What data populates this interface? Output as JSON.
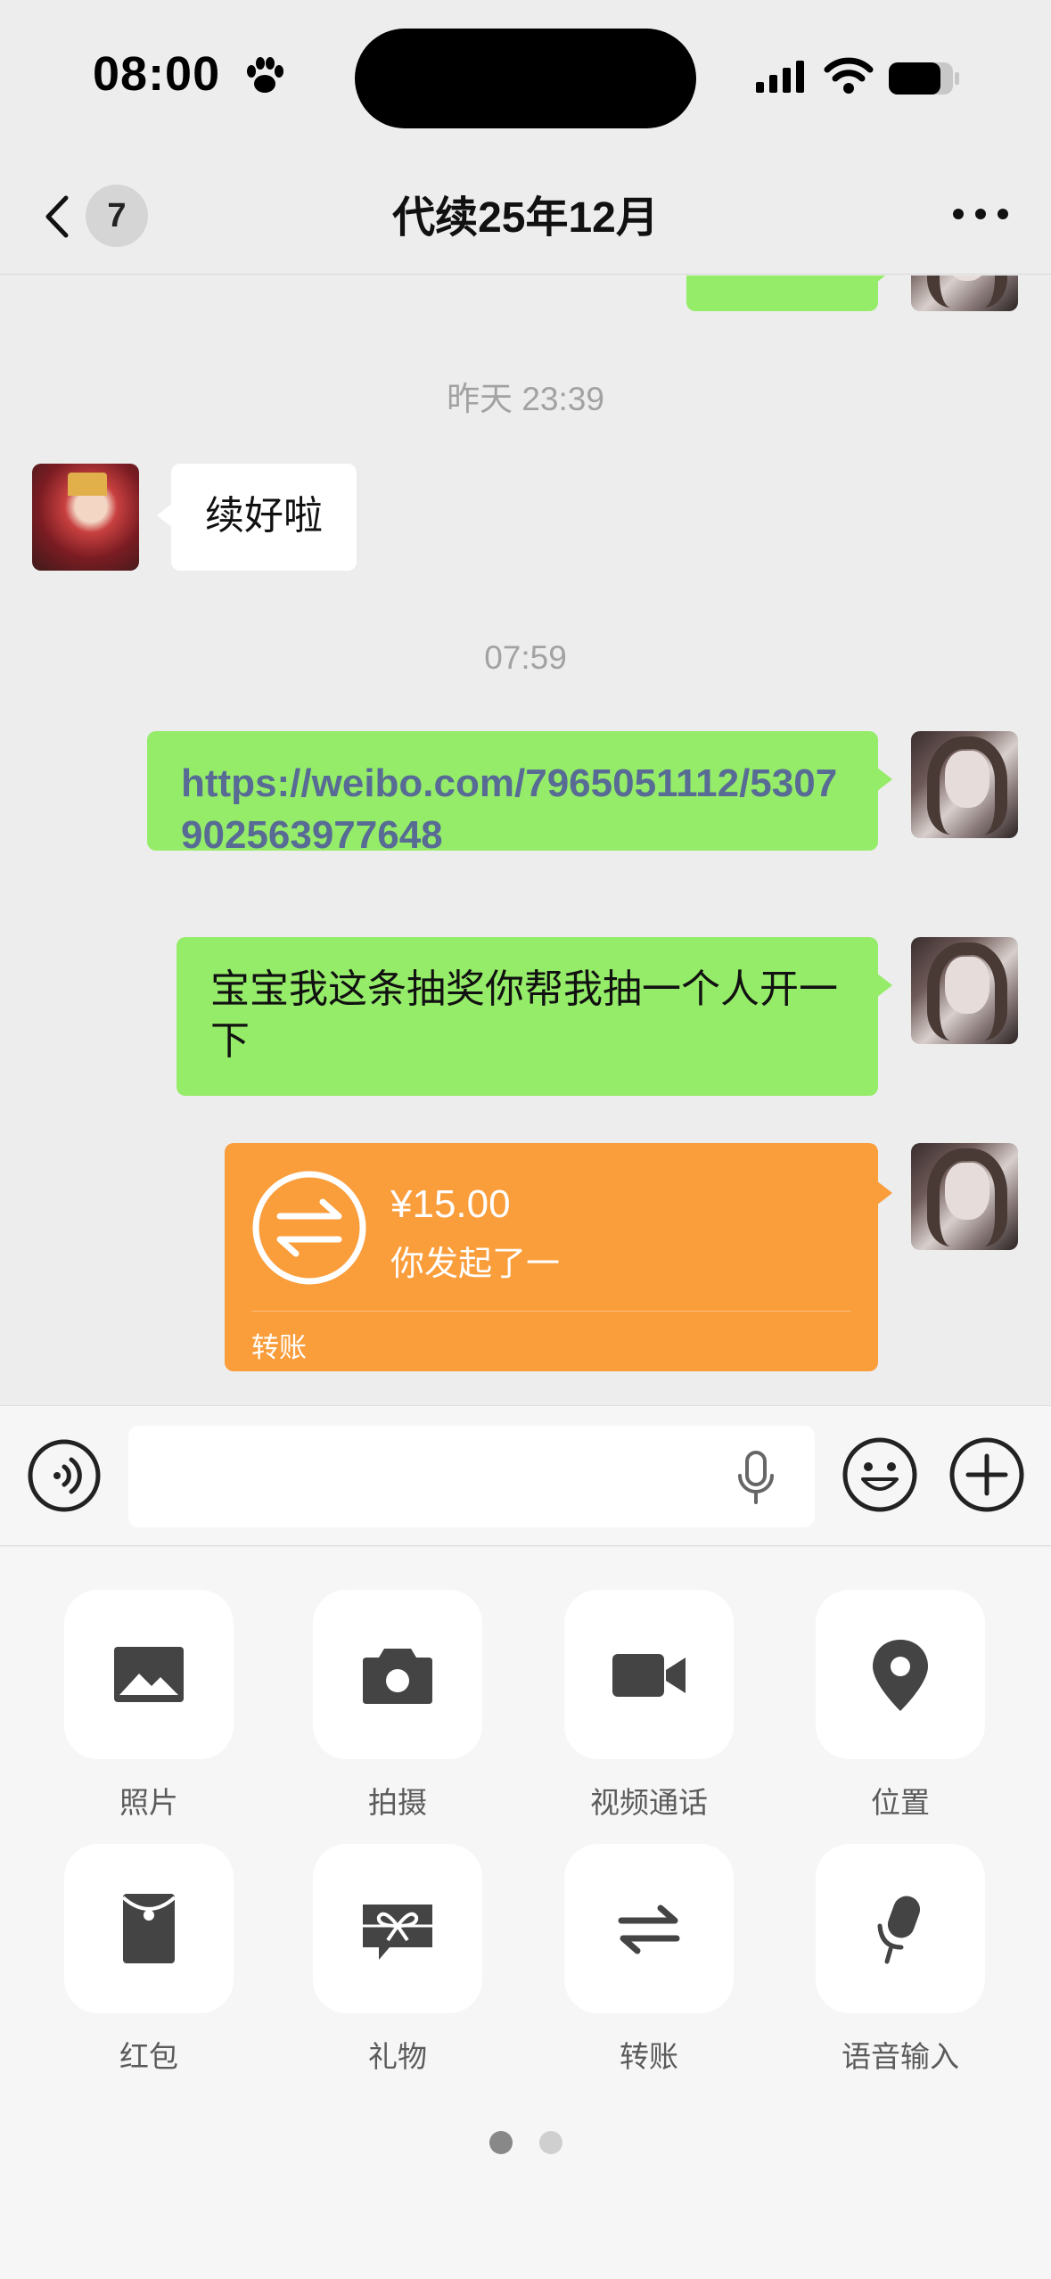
{
  "status_bar": {
    "time": "08:00"
  },
  "nav": {
    "unread_count": "7",
    "title": "代续25年12月"
  },
  "messages": {
    "ts1": "昨天 23:39",
    "received_1": "续好啦",
    "ts2": "07:59",
    "sent_link": "https://weibo.com/7965051112/5307902563977648",
    "sent_text": "宝宝我这条抽奖你帮我抽一个人开一下",
    "transfer": {
      "amount": "¥15.00",
      "desc": "你发起了一",
      "label": "转账"
    }
  },
  "tools": {
    "photo": "照片",
    "camera": "拍摄",
    "video_call": "视频通话",
    "location": "位置",
    "red_packet": "红包",
    "gift": "礼物",
    "transfer": "转账",
    "voice_input": "语音输入"
  },
  "colors": {
    "sent_bubble": "#95ec69",
    "transfer_card": "#fa9d3b",
    "link": "#576b95"
  }
}
